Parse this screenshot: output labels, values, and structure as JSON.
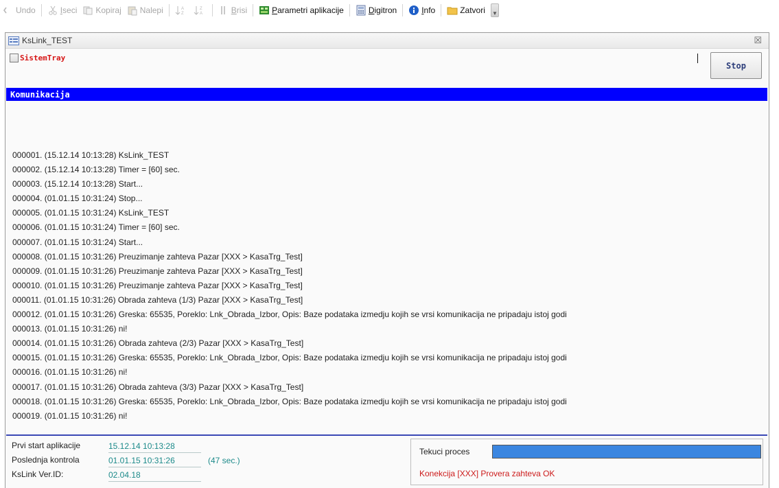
{
  "toolbar": {
    "items": [
      {
        "label": "Undo",
        "icon": "undo-icon"
      },
      {
        "label": "Iseci",
        "icon": "cut-icon"
      },
      {
        "label": "Kopiraj",
        "icon": "copy-icon"
      },
      {
        "label": "Nalepi",
        "icon": "paste-icon"
      },
      {
        "label": "Brisi",
        "icon": "delete-icon"
      },
      {
        "label": "Parametri aplikacije",
        "icon": "settings-icon"
      },
      {
        "label": "Digitron",
        "icon": "calculator-icon"
      },
      {
        "label": "Info",
        "icon": "info-icon"
      },
      {
        "label": "Zatvori",
        "icon": "folder-icon"
      }
    ]
  },
  "window": {
    "title": "KsLink_TEST",
    "close_symbol": "☒",
    "tray_label": "SistemTray",
    "tray_checked": false,
    "stop_label": "Stop",
    "section_title": "Komunikacija"
  },
  "log": [
    "000001. (15.12.14 10:13:28) KsLink_TEST",
    "000002. (15.12.14 10:13:28) Timer = [60] sec.",
    "000003. (15.12.14 10:13:28) Start...",
    "000004. (01.01.15 10:31:24) Stop...",
    "000005. (01.01.15 10:31:24) KsLink_TEST",
    "000006. (01.01.15 10:31:24) Timer = [60] sec.",
    "000007. (01.01.15 10:31:24) Start...",
    "000008. (01.01.15 10:31:26) Preuzimanje zahteva Pazar [XXX > KasaTrg_Test]",
    "000009. (01.01.15 10:31:26) Preuzimanje zahteva Pazar [XXX > KasaTrg_Test]",
    "000010. (01.01.15 10:31:26) Preuzimanje zahteva Pazar [XXX > KasaTrg_Test]",
    "000011. (01.01.15 10:31:26) Obrada zahteva (1/3) Pazar [XXX > KasaTrg_Test]",
    "000012. (01.01.15 10:31:26) Greska: 65535, Poreklo: Lnk_Obrada_Izbor, Opis: Baze podataka izmedju kojih se vrsi komunikacija ne pripadaju istoj godi",
    "000013. (01.01.15 10:31:26) ni!",
    "000014. (01.01.15 10:31:26) Obrada zahteva (2/3) Pazar [XXX > KasaTrg_Test]",
    "000015. (01.01.15 10:31:26) Greska: 65535, Poreklo: Lnk_Obrada_Izbor, Opis: Baze podataka izmedju kojih se vrsi komunikacija ne pripadaju istoj godi",
    "000016. (01.01.15 10:31:26) ni!",
    "000017. (01.01.15 10:31:26) Obrada zahteva (3/3) Pazar [XXX > KasaTrg_Test]",
    "000018. (01.01.15 10:31:26) Greska: 65535, Poreklo: Lnk_Obrada_Izbor, Opis: Baze podataka izmedju kojih se vrsi komunikacija ne pripadaju istoj godi",
    "000019. (01.01.15 10:31:26) ni!"
  ],
  "status": {
    "first_start_label": "Prvi start aplikacije",
    "first_start_value": "15.12.14 10:13:28",
    "last_check_label": "Poslednja kontrola",
    "last_check_value": "01.01.15 10:31:26",
    "last_check_extra": "(47 sec.)",
    "version_label": "KsLink Ver.ID:",
    "version_value": "02.04.18"
  },
  "process": {
    "label": "Tekuci proces",
    "progress": 1.0,
    "status_text": "Konekcija [XXX] Provera zahteva OK"
  },
  "colors": {
    "section_bar": "#0000ff",
    "tray_label": "#d61515",
    "progress_fill": "#3b86e0",
    "value_text": "#1c8a8a",
    "status_text": "#cc1a1a"
  }
}
